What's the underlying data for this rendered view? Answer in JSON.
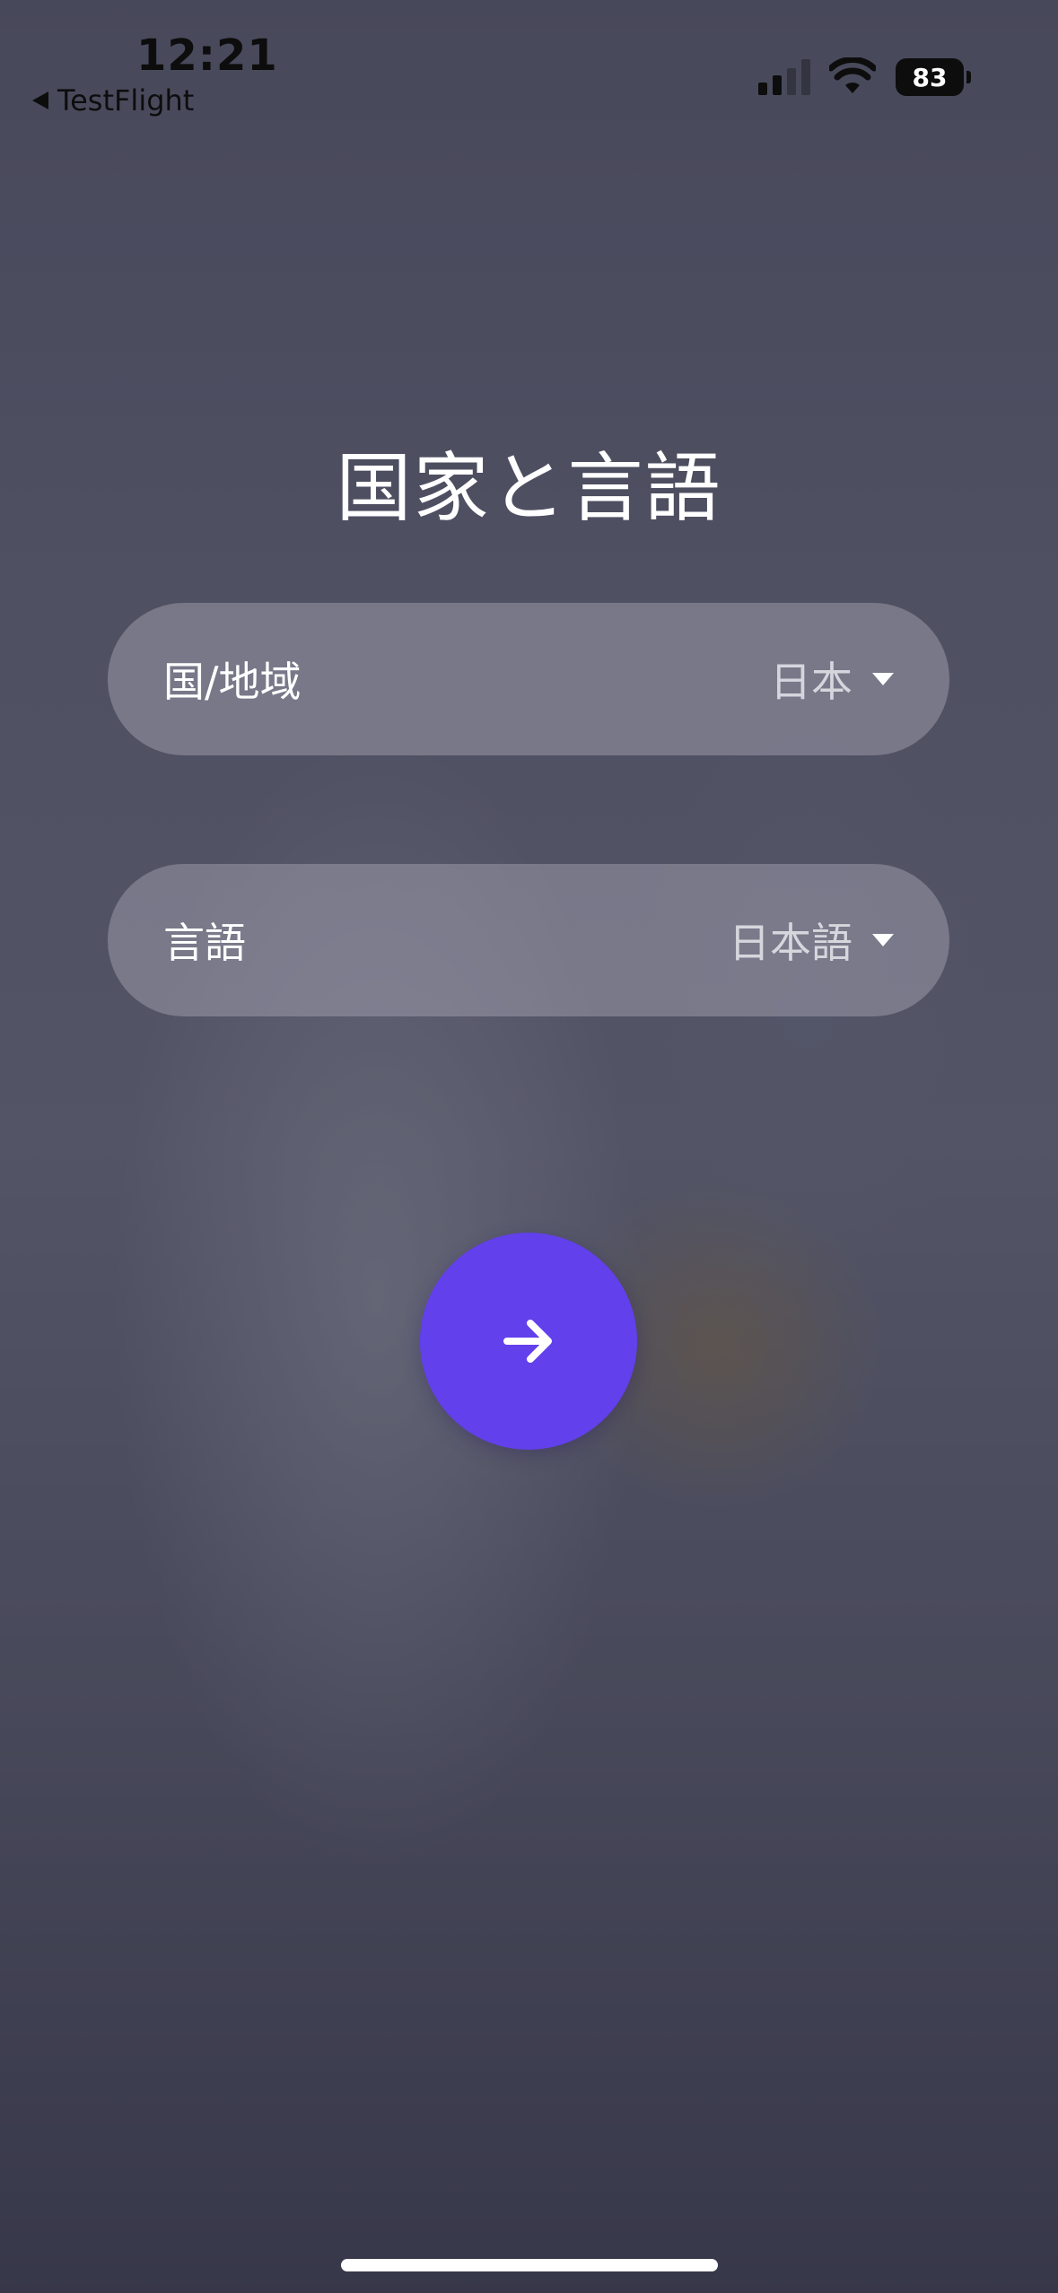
{
  "status_bar": {
    "time": "12:21",
    "back_app": "TestFlight",
    "battery_level": "83",
    "signal_bars_active": 2,
    "signal_bars_total": 4
  },
  "title": "国家と言語",
  "country_selector": {
    "label": "国/地域",
    "value": "日本"
  },
  "language_selector": {
    "label": "言語",
    "value": "日本語"
  },
  "next_button": {
    "icon": "arrow-right-icon"
  },
  "colors": {
    "accent": "#6240ec",
    "selector_bg": "rgba(165,163,180,0.48)",
    "text": "#ffffff"
  }
}
